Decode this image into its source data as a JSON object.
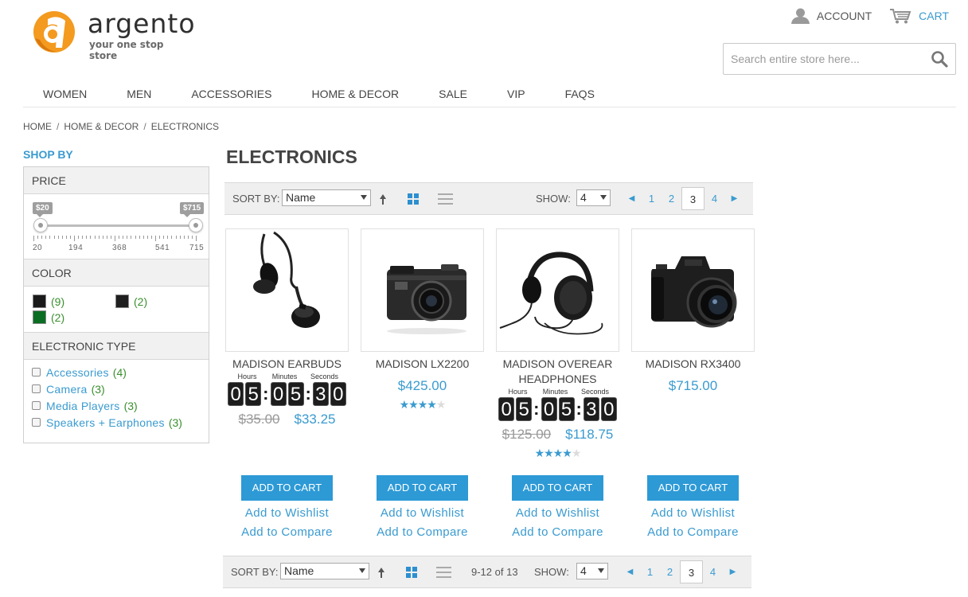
{
  "brand": {
    "name": "argento",
    "tagline": "your one stop store"
  },
  "header": {
    "account_label": "ACCOUNT",
    "cart_label": "CART",
    "search_placeholder": "Search entire store here..."
  },
  "nav": [
    "WOMEN",
    "MEN",
    "ACCESSORIES",
    "HOME & DECOR",
    "SALE",
    "VIP",
    "FAQS"
  ],
  "breadcrumb": [
    "HOME",
    "HOME & DECOR",
    "ELECTRONICS"
  ],
  "sidebar": {
    "title": "SHOP BY",
    "price": {
      "heading": "PRICE",
      "min_label": "$20",
      "max_label": "$715",
      "ticks": [
        "20",
        "194",
        "368",
        "541",
        "715"
      ]
    },
    "color": {
      "heading": "COLOR",
      "swatches": [
        {
          "color": "#1a1a1a",
          "count": "(9)"
        },
        {
          "color": "#1f1f1f",
          "count": "(2)"
        },
        {
          "color": "#0a6e22",
          "count": "(2)"
        }
      ]
    },
    "type": {
      "heading": "ELECTRONIC TYPE",
      "items": [
        {
          "label": "Accessories",
          "count": "(4)"
        },
        {
          "label": "Camera",
          "count": "(3)"
        },
        {
          "label": "Media Players",
          "count": "(3)"
        },
        {
          "label": "Speakers + Earphones",
          "count": "(3)"
        }
      ]
    }
  },
  "main": {
    "title": "ELECTRONICS",
    "toolbar": {
      "sort_label": "SORT BY:",
      "sort_value": "Name",
      "show_label": "SHOW:",
      "show_value": "4",
      "pages": [
        "1",
        "2",
        "3",
        "4"
      ],
      "current_page": "3",
      "count_text": "9-12 of 13"
    },
    "countdown_labels": {
      "hours": "Hours",
      "minutes": "Minutes",
      "seconds": "Seconds"
    },
    "products": [
      {
        "name": "MADISON EARBUDS",
        "has_countdown": true,
        "countdown": [
          "0",
          "5",
          "0",
          "5",
          "3",
          "0"
        ],
        "old_price": "$35.00",
        "new_price": "$33.25",
        "rating": 0,
        "image": "earbuds"
      },
      {
        "name": "MADISON LX2200",
        "has_countdown": false,
        "price": "$425.00",
        "rating": 4,
        "image": "compact-camera"
      },
      {
        "name": "MADISON OVEREAR HEADPHONES",
        "has_countdown": true,
        "countdown": [
          "0",
          "5",
          "0",
          "5",
          "3",
          "0"
        ],
        "old_price": "$125.00",
        "new_price": "$118.75",
        "rating": 4,
        "image": "headphones"
      },
      {
        "name": "MADISON RX3400",
        "has_countdown": false,
        "price": "$715.00",
        "rating": 0,
        "image": "dslr-camera"
      }
    ],
    "actions": {
      "add_to_cart": "ADD TO CART",
      "add_to_wishlist": "Add to Wishlist",
      "add_to_compare": "Add to Compare"
    }
  }
}
